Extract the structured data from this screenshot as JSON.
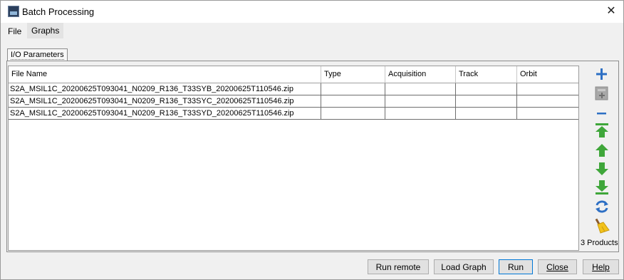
{
  "window": {
    "title": "Batch Processing",
    "close_glyph": "✕"
  },
  "menubar": {
    "items": [
      {
        "label": "File"
      },
      {
        "label": "Graphs"
      }
    ]
  },
  "tabs": [
    {
      "label": "I/O Parameters"
    }
  ],
  "table": {
    "columns": [
      "File Name",
      "Type",
      "Acquisition",
      "Track",
      "Orbit"
    ],
    "rows": [
      [
        "S2A_MSIL1C_20200625T093041_N0209_R136_T33SYB_20200625T110546.zip",
        "",
        "",
        "",
        ""
      ],
      [
        "S2A_MSIL1C_20200625T093041_N0209_R136_T33SYC_20200625T110546.zip",
        "",
        "",
        "",
        ""
      ],
      [
        "S2A_MSIL1C_20200625T093041_N0209_R136_T33SYD_20200625T110546.zip",
        "",
        "",
        "",
        ""
      ]
    ]
  },
  "side_toolbar": {
    "icons": [
      "add-icon",
      "add-opened-icon",
      "remove-icon",
      "move-top-icon",
      "move-up-icon",
      "move-down-icon",
      "move-bottom-icon",
      "refresh-icon",
      "clear-icon"
    ],
    "product_count": "3 Products"
  },
  "buttons": {
    "run_remote": "Run remote",
    "load_graph": "Load Graph",
    "run": "Run",
    "close": "Close",
    "help": "Help"
  },
  "colors": {
    "accent_blue": "#2d6fc4",
    "green": "#3fa63a",
    "focus": "#0078d7"
  }
}
